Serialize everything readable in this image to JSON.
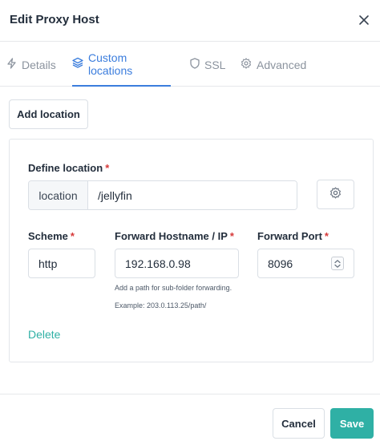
{
  "modal": {
    "title": "Edit Proxy Host"
  },
  "tabs": [
    {
      "label": "Details",
      "icon": "bolt-icon",
      "active": false
    },
    {
      "label": "Custom locations",
      "icon": "layers-icon",
      "active": true
    },
    {
      "label": "SSL",
      "icon": "shield-icon",
      "active": false
    },
    {
      "label": "Advanced",
      "icon": "gear-icon",
      "active": false
    }
  ],
  "add_location_label": "Add location",
  "location": {
    "define_label": "Define location",
    "required_mark": "*",
    "prefix": "location",
    "path_value": "/jellyfin",
    "scheme_label": "Scheme",
    "scheme_value": "http",
    "host_label": "Forward Hostname / IP",
    "host_value": "192.168.0.98",
    "host_hint_1": "Add a path for sub-folder forwarding.",
    "host_hint_2": "Example: 203.0.113.25/path/",
    "port_label": "Forward Port",
    "port_value": "8096",
    "delete_label": "Delete"
  },
  "footer": {
    "cancel_label": "Cancel",
    "save_label": "Save"
  },
  "colors": {
    "accent_blue": "#3b7ddd",
    "teal": "#2fb0a5",
    "required_red": "#d63939"
  }
}
